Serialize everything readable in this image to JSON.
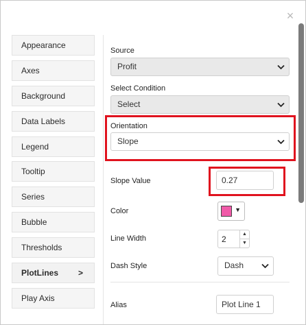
{
  "top_scrap_text": "",
  "close_glyph": "×",
  "nav": {
    "items": [
      {
        "label": "Appearance"
      },
      {
        "label": "Axes"
      },
      {
        "label": "Background"
      },
      {
        "label": "Data Labels"
      },
      {
        "label": "Legend"
      },
      {
        "label": "Tooltip"
      },
      {
        "label": "Series"
      },
      {
        "label": "Bubble"
      },
      {
        "label": "Thresholds"
      },
      {
        "label": "PlotLines",
        "active": true,
        "chevron": ">"
      },
      {
        "label": "Play Axis"
      }
    ]
  },
  "form": {
    "source": {
      "label": "Source",
      "value": "Profit"
    },
    "condition": {
      "label": "Select Condition",
      "value": "Select"
    },
    "orientation": {
      "label": "Orientation",
      "value": "Slope"
    },
    "slope": {
      "label": "Slope Value",
      "value": "0.27"
    },
    "color": {
      "label": "Color",
      "value": "#f05aa8"
    },
    "line_width": {
      "label": "Line Width",
      "value": "2"
    },
    "dash_style": {
      "label": "Dash Style",
      "value": "Dash"
    },
    "alias": {
      "label": "Alias",
      "value": "Plot Line 1"
    }
  },
  "colors": {
    "highlight": "#e0121e",
    "swatch": "#f05aa8"
  }
}
